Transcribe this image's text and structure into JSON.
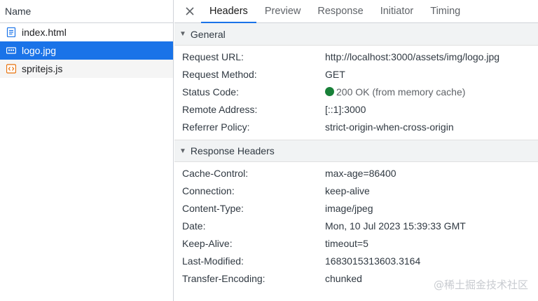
{
  "file_list": {
    "header": "Name",
    "items": [
      {
        "name": "index.html",
        "icon": "document-icon",
        "color": "#1a73e8"
      },
      {
        "name": "logo.jpg",
        "icon": "image-icon",
        "color": "#ffffff"
      },
      {
        "name": "spritejs.js",
        "icon": "script-icon",
        "color": "#e8710a"
      }
    ]
  },
  "tabs": [
    "Headers",
    "Preview",
    "Response",
    "Initiator",
    "Timing"
  ],
  "general": {
    "title": "General",
    "rows": [
      {
        "k": "Request URL:",
        "v": "http://localhost:3000/assets/img/logo.jpg"
      },
      {
        "k": "Request Method:",
        "v": "GET"
      },
      {
        "k": "Status Code:",
        "v": "200 OK (from memory cache)"
      },
      {
        "k": "Remote Address:",
        "v": "[::1]:3000"
      },
      {
        "k": "Referrer Policy:",
        "v": "strict-origin-when-cross-origin"
      }
    ]
  },
  "response_headers": {
    "title": "Response Headers",
    "rows": [
      {
        "k": "Cache-Control:",
        "v": "max-age=86400"
      },
      {
        "k": "Connection:",
        "v": "keep-alive"
      },
      {
        "k": "Content-Type:",
        "v": "image/jpeg"
      },
      {
        "k": "Date:",
        "v": "Mon, 10 Jul 2023 15:39:33 GMT"
      },
      {
        "k": "Keep-Alive:",
        "v": "timeout=5"
      },
      {
        "k": "Last-Modified:",
        "v": "1683015313603.3164"
      },
      {
        "k": "Transfer-Encoding:",
        "v": "chunked"
      }
    ]
  },
  "status_color": "#188038",
  "accent": "#1a73e8",
  "watermark": "@稀土掘金技术社区"
}
